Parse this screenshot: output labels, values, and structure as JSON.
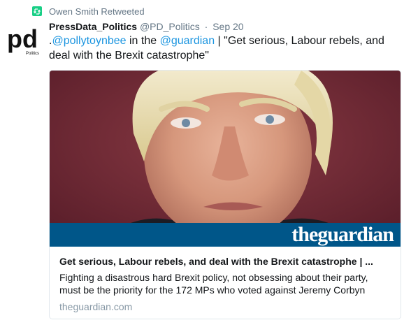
{
  "retweet": {
    "label": "Owen Smith Retweeted"
  },
  "avatar": {
    "letters": "pd",
    "sub": "Politics"
  },
  "tweet": {
    "name": "PressData_Politics",
    "handle": "@PD_Politics",
    "separator": "·",
    "date": "Sep 20",
    "text_prefix": ".",
    "mention1": "@pollytoynbee",
    "text_mid": " in the ",
    "mention2": "@guardian",
    "text_rest": " | \"Get serious, Labour rebels, and deal with the Brexit catastrophe\""
  },
  "card": {
    "brand": "theguardian",
    "title": "Get serious, Labour rebels, and deal with the Brexit catastrophe | ...",
    "description": "Fighting a disastrous hard Brexit policy, not obsessing about their party, must be the priority for the 172 MPs who voted against Jeremy Corbyn",
    "domain": "theguardian.com"
  },
  "colors": {
    "accent": "#1b95e0",
    "retweet": "#19cf86",
    "guardian_band": "#005689"
  }
}
